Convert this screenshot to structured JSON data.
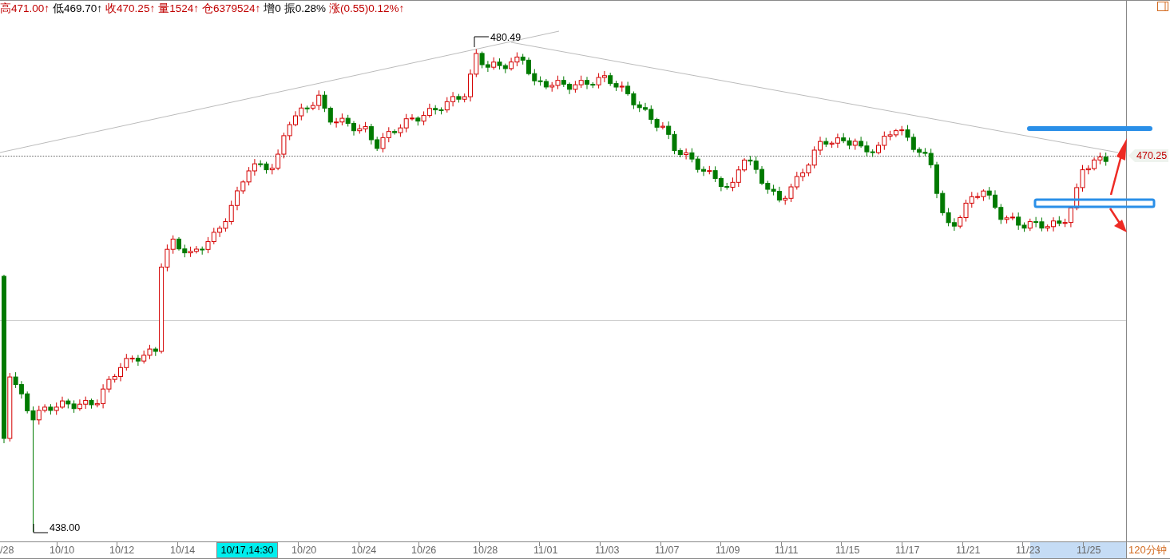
{
  "quote_bar": [
    {
      "text": "高471.00↑",
      "color": "#c00000"
    },
    {
      "text": "低469.70↑",
      "color": "#000000"
    },
    {
      "text": "收470.25↑",
      "color": "#c00000"
    },
    {
      "text": "量1524↑",
      "color": "#c00000"
    },
    {
      "text": "仓6379524↑",
      "color": "#c00000"
    },
    {
      "text": "增0",
      "color": "#000000"
    },
    {
      "text": "振0.28%",
      "color": "#000000"
    },
    {
      "text": "涨(0.55)0.12%↑",
      "color": "#c00000"
    }
  ],
  "chart": {
    "high_marker": "480.49",
    "low_marker": "438.00",
    "last_price": "470.25"
  },
  "x_axis": {
    "ticks": [
      "/28",
      "10/10",
      "10/12",
      "10/14",
      "10/20",
      "10/24",
      "10/26",
      "10/28",
      "11/01",
      "11/03",
      "11/07",
      "11/09",
      "11/11",
      "11/15",
      "11/17",
      "11/21",
      "11/23",
      "11/25"
    ],
    "cursor_label": "10/17,14:30",
    "period": "120分钟"
  }
}
